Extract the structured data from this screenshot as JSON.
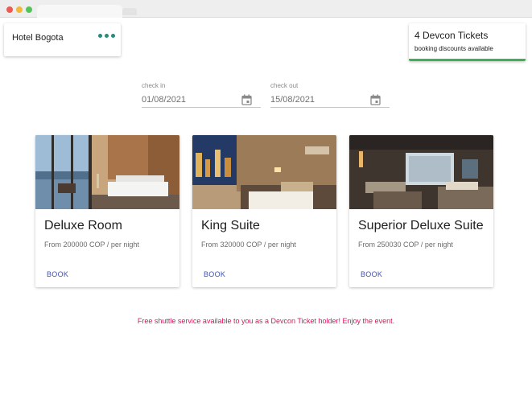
{
  "window": {
    "controls": [
      "close",
      "minimize",
      "maximize"
    ],
    "colors": {
      "close": "#ec5b53",
      "minimize": "#f2b83a",
      "maximize": "#56c25a"
    }
  },
  "hotel": {
    "name": "Hotel Bogota",
    "menu_icon": "more-horizontal-icon",
    "accent": "#2a8a7c"
  },
  "tickets": {
    "title": "4 Devcon Tickets",
    "subtitle": "booking discounts available",
    "accent": "#3db154"
  },
  "dates": {
    "check_in": {
      "label": "check in",
      "value": "01/08/2021",
      "icon": "calendar-icon"
    },
    "check_out": {
      "label": "check out",
      "value": "15/08/2021",
      "icon": "calendar-icon"
    }
  },
  "rooms": [
    {
      "title": "Deluxe Room",
      "price": "From 200000 COP / per night",
      "action": "BOOK"
    },
    {
      "title": "King Suite",
      "price": "From 320000 COP / per night",
      "action": "BOOK"
    },
    {
      "title": "Superior Deluxe Suite",
      "price": "From 250030 COP / per night",
      "action": "BOOK"
    }
  ],
  "notice": {
    "text": "Free shuttle service available to you as a Devcon Ticket holder! Enjoy the event.",
    "color": "#e0115f"
  },
  "colors": {
    "link": "#3f51b5"
  }
}
